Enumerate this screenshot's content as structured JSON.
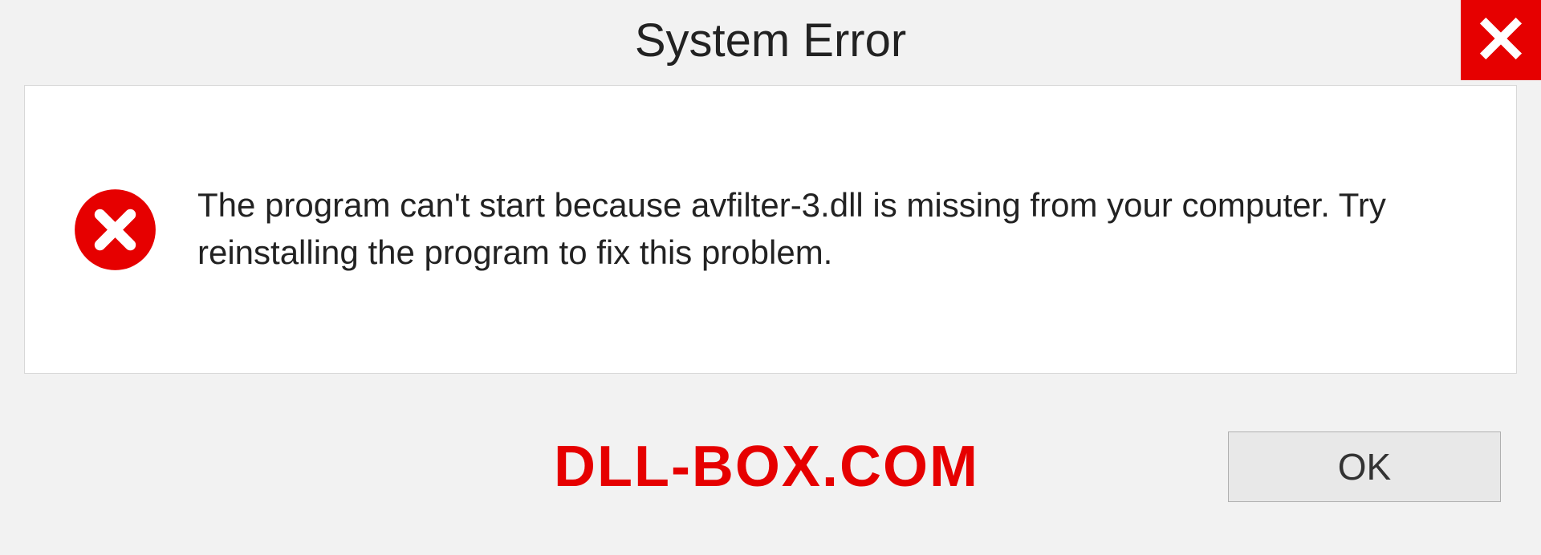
{
  "dialog": {
    "title": "System Error",
    "message": "The program can't start because avfilter-3.dll is missing from your computer. Try reinstalling the program to fix this problem.",
    "ok_label": "OK"
  },
  "watermark": "DLL-BOX.COM",
  "colors": {
    "accent_red": "#e60000",
    "background": "#f2f2f2"
  }
}
